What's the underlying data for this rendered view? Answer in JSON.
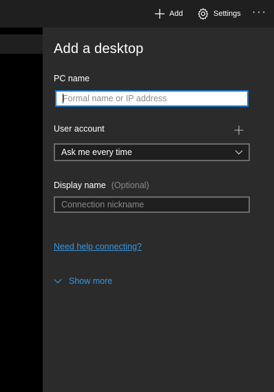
{
  "toolbar": {
    "add_label": "Add",
    "settings_label": "Settings",
    "more_label": "···"
  },
  "panel": {
    "title": "Add a desktop",
    "pc_name": {
      "label": "PC name",
      "value": "",
      "placeholder": "Formal name or IP address"
    },
    "user_account": {
      "label": "User account",
      "selected": "Ask me every time"
    },
    "display_name": {
      "label": "Display name",
      "optional_label": "(Optional)",
      "value": "",
      "placeholder": "Connection nickname"
    },
    "help_link": "Need help connecting?",
    "show_more": "Show more"
  },
  "colors": {
    "accent": "#3a96dd",
    "focus_border": "#1e7fd6",
    "panel_bg": "#2b2b2b",
    "app_bg": "#1f1f1f"
  },
  "icons": {
    "add": "plus-icon",
    "settings": "gear-icon",
    "more": "ellipsis-icon",
    "dropdown": "chevron-down-icon",
    "add_user": "plus-icon",
    "show_more": "chevron-down-icon"
  }
}
